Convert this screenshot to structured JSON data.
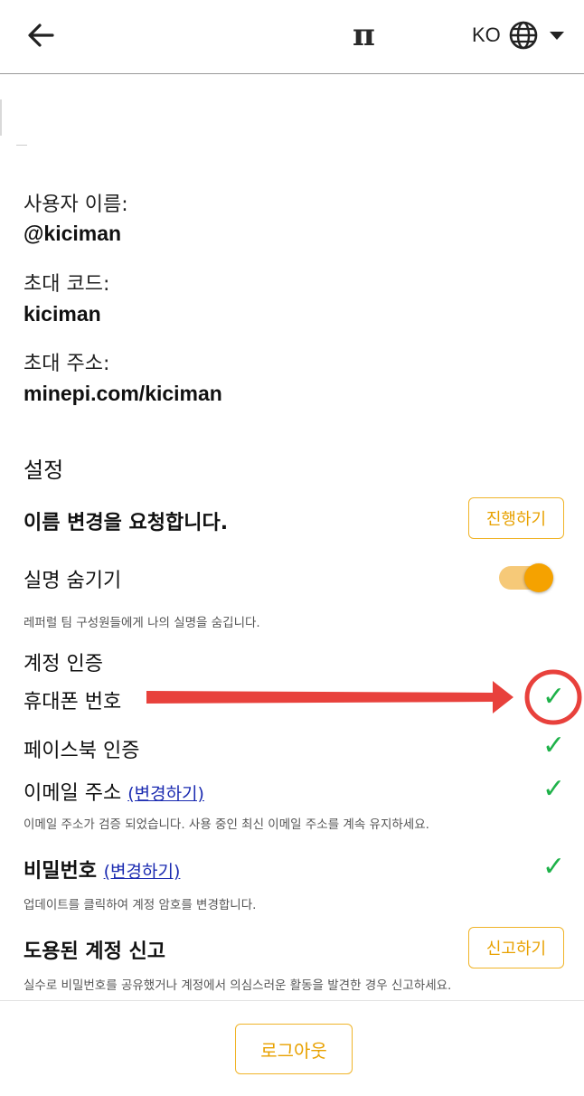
{
  "header": {
    "back_icon": "arrow-left-icon",
    "logo": "π",
    "lang_code": "KO",
    "globe_icon": "globe-icon",
    "dropdown_icon": "caret-down-icon"
  },
  "profile": {
    "username_label": "사용자 이름:",
    "username_value": "@kiciman",
    "invite_code_label": "초대 코드:",
    "invite_code_value": "kiciman",
    "invite_url_label": "초대 주소:",
    "invite_url_value": "minepi.com/kiciman"
  },
  "settings": {
    "title": "설정",
    "name_change": {
      "label": "이름 변경을 요청합니다.",
      "button": "진행하기"
    },
    "hide_real_name": {
      "label": "실명 숨기기",
      "hint": "레퍼럴 팀 구성원들에게 나의 실명을 숨깁니다.",
      "enabled": true
    },
    "verification_title": "계정 인증",
    "phone": {
      "label": "휴대폰 번호",
      "status": "✓"
    },
    "facebook": {
      "label": "페이스북 인증",
      "status": "✓"
    },
    "email": {
      "label": "이메일 주소",
      "link": "(변경하기)",
      "status": "✓",
      "hint": "이메일 주소가 검증 되었습니다. 사용 중인 최신 이메일 주소를 계속 유지하세요."
    },
    "password": {
      "label": "비밀번호",
      "link": "(변경하기)",
      "status": "✓",
      "hint": "업데이트를 클릭하여 계정 암호를 변경합니다."
    },
    "report": {
      "label": "도용된 계정 신고",
      "button": "신고하기",
      "hint": "실수로 비밀번호를 공유했거나 계정에서 의심스러운 활동을 발견한 경우 신고하세요."
    }
  },
  "footer": {
    "logout": "로그아웃"
  },
  "colors": {
    "accent": "#f5a200",
    "check": "#1fb24a",
    "annotation": "#e8413c"
  }
}
